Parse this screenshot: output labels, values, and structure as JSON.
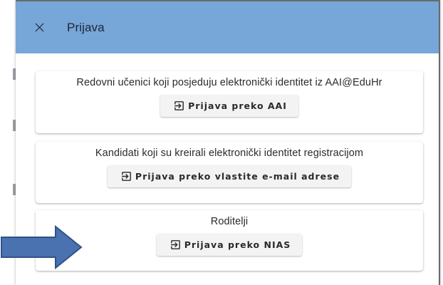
{
  "dialog": {
    "title": "Prijava",
    "close_icon": "close-icon"
  },
  "options": [
    {
      "description": "Redovni učenici koji posjeduju elektronički identitet iz AAI@EduHr",
      "button_label": "Prijava preko AAI",
      "button_icon": "login-icon"
    },
    {
      "description": "Kandidati koji su kreirali elektronički identitet registracijom",
      "button_label": "Prijava preko vlastite e-mail adrese",
      "button_icon": "login-icon"
    },
    {
      "description": "Roditelji",
      "button_label": "Prijava preko NIAS",
      "button_icon": "login-icon"
    }
  ],
  "annotation": {
    "pointer": "right-arrow-icon",
    "color": "#4a72b0"
  },
  "colors": {
    "header": "#77a6d9",
    "button_bg": "#f3f3f3"
  }
}
